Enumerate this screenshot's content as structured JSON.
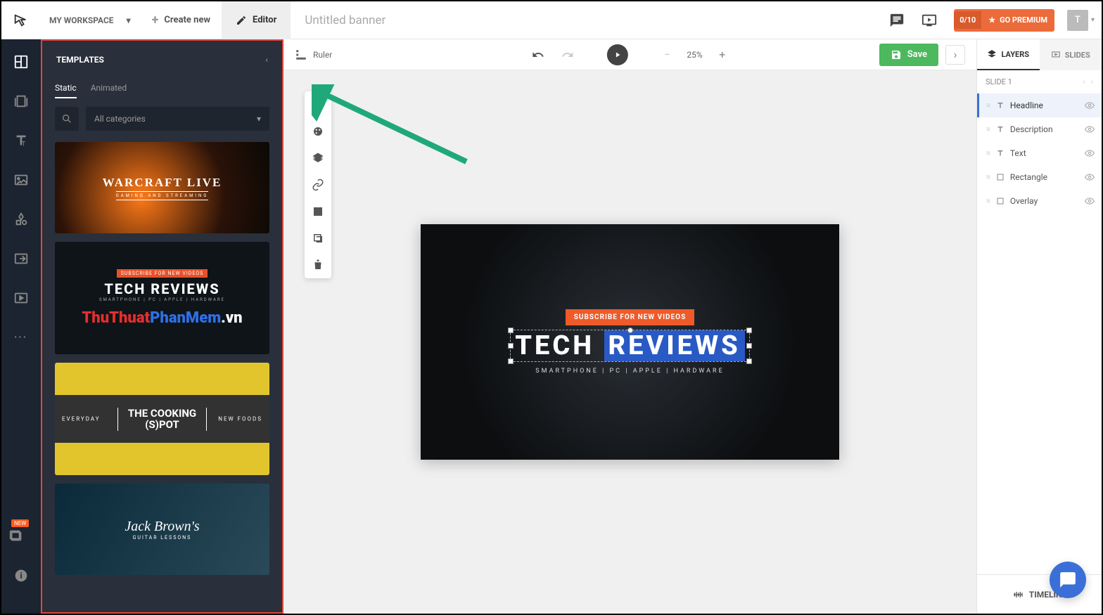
{
  "topbar": {
    "workspace": "MY WORKSPACE",
    "create_new": "Create new",
    "editor": "Editor",
    "doc_title": "Untitled banner",
    "premium_badge": "0/10",
    "premium_label": "GO PREMIUM",
    "avatar_initial": "T"
  },
  "sidepanel": {
    "title": "TEMPLATES",
    "tabs": {
      "static": "Static",
      "animated": "Animated"
    },
    "category_dd": "All categories"
  },
  "templates": {
    "t1_title": "WARCRAFT LIVE",
    "t1_sub": "GAMING AND STREAMING",
    "t2_sub": "SUBSCRIBE FOR NEW VIDEOS",
    "t2_title": "TECH REVIEWS",
    "t2_desc": "SMARTPHONE | PC | APPLE | HARDWARE",
    "t2_watermark": "ThuThuatPhanMem.vn",
    "t3_left": "EVERYDAY",
    "t3_mid1": "THE COOKING",
    "t3_mid2": "(S)POT",
    "t3_right": "NEW FOODS",
    "t4_title": "Jack Brown's",
    "t4_sub": "GUITAR LESSONS"
  },
  "toolbar": {
    "ruler": "Ruler",
    "zoom": "25%",
    "save": "Save"
  },
  "banner": {
    "badge": "SUBSCRIBE FOR NEW VIDEOS",
    "headline_a": "TECH ",
    "headline_b": "REVIEWS",
    "desc": "SMARTPHONE  |  PC  |  APPLE  |  HARDWARE"
  },
  "rightpanel": {
    "tab_layers": "LAYERS",
    "tab_slides": "SLIDES",
    "slide_label": "SLIDE 1",
    "timeline": "TIMELINE"
  },
  "layers": [
    {
      "name": "Headline",
      "type": "text",
      "active": true
    },
    {
      "name": "Description",
      "type": "text",
      "active": false
    },
    {
      "name": "Text",
      "type": "text",
      "active": false
    },
    {
      "name": "Rectangle",
      "type": "shape",
      "active": false
    },
    {
      "name": "Overlay",
      "type": "shape",
      "active": false
    }
  ],
  "new_badge": "NEW"
}
